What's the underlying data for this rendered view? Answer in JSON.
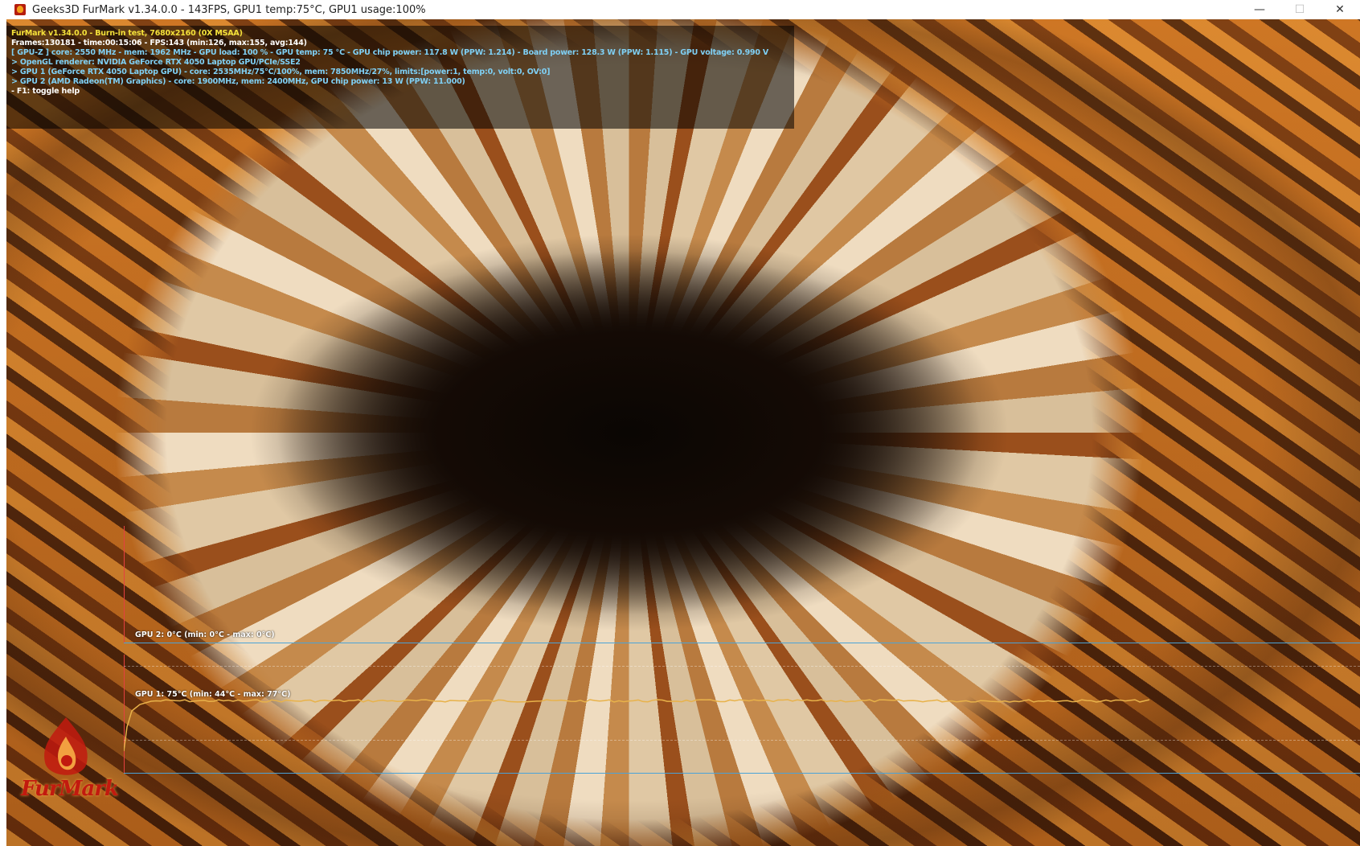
{
  "window": {
    "title": "Geeks3D FurMark v1.34.0.0 - 143FPS, GPU1 temp:75°C, GPU1 usage:100%",
    "controls": {
      "minimize": "—",
      "maximize": "☐",
      "close": "✕"
    }
  },
  "osd": {
    "lines": [
      {
        "text": "FurMark v1.34.0.0 - Burn-in test, 7680x2160 (0X MSAA)",
        "color": "#f5e23a"
      },
      {
        "text": "Frames:130181 - time:00:15:06 - FPS:143 (min:126, max:155, avg:144)",
        "color": "#ffffff"
      },
      {
        "text": "[ GPU-Z ] core: 2550 MHz - mem: 1962 MHz - GPU load: 100 % - GPU temp: 75 °C - GPU chip power: 117.8 W (PPW: 1.214) - Board power: 128.3 W (PPW: 1.115) - GPU voltage: 0.990 V",
        "color": "#7fd0f5"
      },
      {
        "text": "> OpenGL renderer: NVIDIA GeForce RTX 4050 Laptop GPU/PCIe/SSE2",
        "color": "#7fd0f5"
      },
      {
        "text": "> GPU 1 (GeForce RTX 4050 Laptop GPU) - core: 2535MHz/75°C/100%, mem: 7850MHz/27%, limits:[power:1, temp:0, volt:0, OV:0]",
        "color": "#7fd0f5"
      },
      {
        "text": "> GPU 2 (AMD Radeon(TM) Graphics) - core: 1900MHz, mem: 2400MHz, GPU chip power: 13 W (PPW: 11.000)",
        "color": "#7fd0f5"
      },
      {
        "text": "- F1: toggle help",
        "color": "#ffffff"
      }
    ]
  },
  "graphs": {
    "gpu2": {
      "label": "GPU 2: 0°C (min: 0°C - max: 0°C)"
    },
    "gpu1": {
      "label": "GPU 1: 75°C (min: 44°C - max: 77°C)",
      "line_color": "#e8b24a"
    }
  },
  "logo": {
    "text": "FurMark"
  },
  "colors": {
    "osd_yellow": "#f5e23a",
    "osd_cyan": "#7fd0f5",
    "graph_axis": "#4aa3d8",
    "graph_left_axis": "#e64040"
  }
}
